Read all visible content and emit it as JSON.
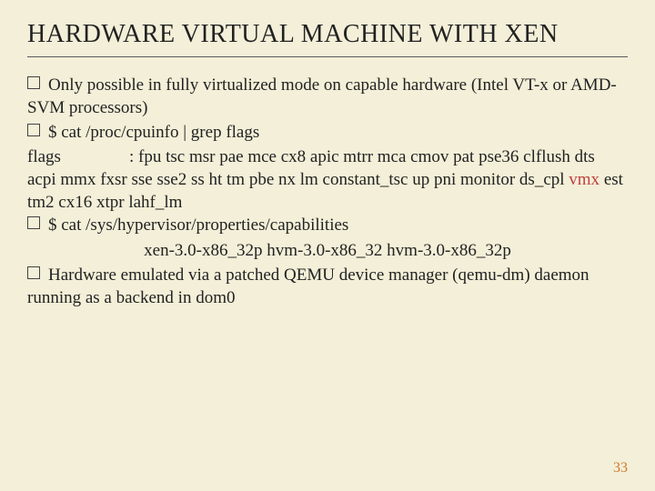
{
  "title": "HARDWARE VIRTUAL MACHINE WITH XEN",
  "bullets": {
    "b1": "Only possible in fully virtualized mode on capable hardware (Intel VT-x or AMD-SVM processors)",
    "b2": "$ cat /proc/cpuinfo | grep flags",
    "b3": "$ cat /sys/hypervisor/properties/capabilities",
    "b4": "Hardware emulated via a patched QEMU device manager (qemu-dm) daemon running as a backend in dom0"
  },
  "flags": {
    "label": "flags",
    "sep": ": ",
    "pre1": "fpu tsc msr pae mce cx8 apic mtrr mca cmov pat pse36 clflush dts acpi mmx fxsr sse sse2 ss ht tm pbe nx lm constant_tsc up pni monitor ds_cpl ",
    "hl": "vmx",
    "post1": " est tm2 cx16 xtpr lahf_lm"
  },
  "caps": "xen-3.0-x86_32p hvm-3.0-x86_32 hvm-3.0-x86_32p",
  "page": "33"
}
